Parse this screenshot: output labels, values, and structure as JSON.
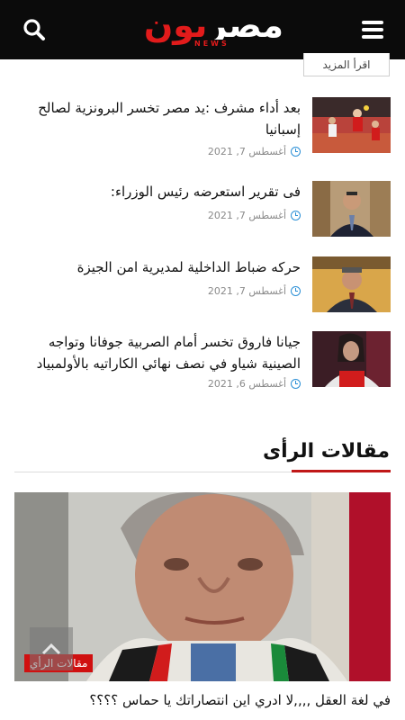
{
  "header": {
    "logo_arabic_part1": "مصر",
    "logo_arabic_part2": "يون",
    "logo_english": "NEWS",
    "search_icon": "search-icon",
    "menu_icon": "hamburger-menu-icon"
  },
  "read_more": "اقرأ المزيد",
  "news": [
    {
      "title": "بعد أداء مشرف :يد مصر تخسر البرونزية لصالح إسبانيا",
      "date": "أغسطس 7, 2021",
      "thumb": "handball-photo"
    },
    {
      "title": "فى تقرير استعرضه رئيس الوزراء:",
      "date": "أغسطس 7, 2021",
      "thumb": "prime-minister-photo"
    },
    {
      "title": "حركه ضباط الداخلية لمديرية امن الجيزة",
      "date": "أغسطس 7, 2021",
      "thumb": "officer-photo"
    },
    {
      "title": "جيانا فاروق تخسر أمام الصربية جوفانا وتواجه الصينية شياو في نصف نهائي الكاراتيه بالأولمبياد",
      "date": "أغسطس 6, 2021",
      "thumb": "karate-athlete-photo"
    }
  ],
  "section": {
    "title": "مقالات الرأى"
  },
  "featured": {
    "badge": "مقالات الرأي",
    "title": "في لغة العقل ,,,,لا ادري اين انتصاراتك يا حماس ؟؟؟؟",
    "image": "man-with-keffiyeh-photo"
  },
  "colors": {
    "header_bg": "#0b0b0b",
    "accent_red": "#c01818",
    "clock_blue": "#2a8fd6"
  }
}
